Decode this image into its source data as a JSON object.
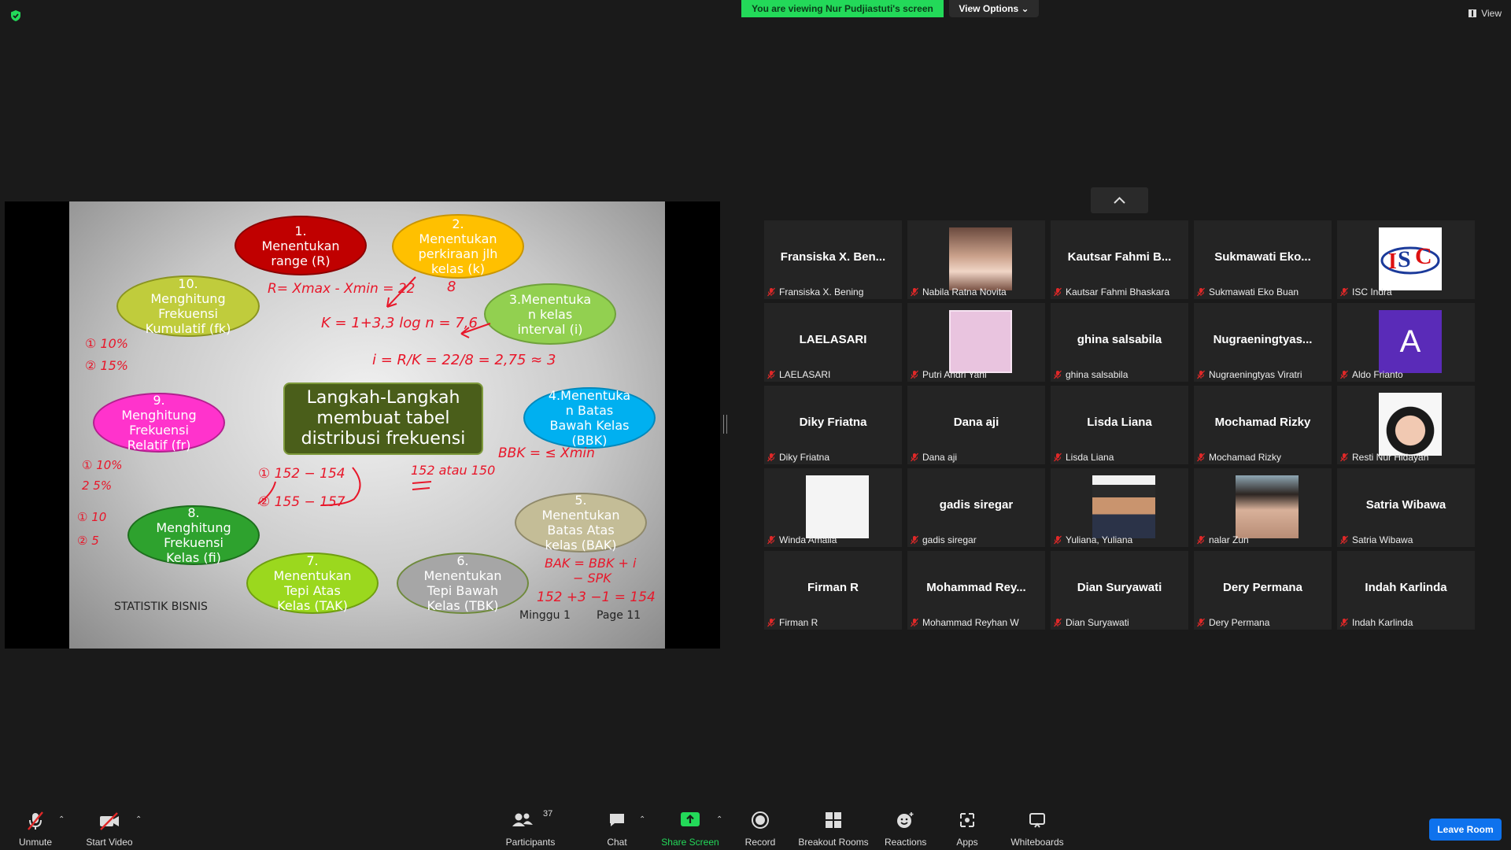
{
  "banner": {
    "viewing_text": "You are viewing Nur Pudjiastuti's screen",
    "view_options_label": "View Options",
    "view_label": "View"
  },
  "slide": {
    "center_title": "Langkah-Langkah\nmembuat tabel\ndistribusi frekuensi",
    "steps": [
      {
        "label": "1.\nMenentukan\nrange (R)",
        "color": "#c00000"
      },
      {
        "label": "2.\nMenentukan\nperkiraan jlh\nkelas (k)",
        "color": "#ffc000"
      },
      {
        "label": "3.Menentuka\nn kelas\ninterval (i)",
        "color": "#92d050"
      },
      {
        "label": "4.Menentuka\nn Batas\nBawah Kelas\n(BBK)",
        "color": "#00b0f0"
      },
      {
        "label": "5.\nMenentukan\nBatas Atas\nkelas (BAK)",
        "color": "#c4bd97"
      },
      {
        "label": "6.\nMenentukan\nTepi Bawah\nKelas (TBK)",
        "color": "#a6a6a6"
      },
      {
        "label": "7.\nMenentukan\nTepi Atas\nKelas (TAK)",
        "color": "#9bd81e"
      },
      {
        "label": "8.\nMenghitung\nFrekuensi\nKelas (fi)",
        "color": "#2ea22e"
      },
      {
        "label": "9.\nMenghitung\nFrekuensi\nRelatif (fr)",
        "color": "#ff33cc"
      },
      {
        "label": "10.\nMenghitung\nFrekuensi\nKumulatif (fk)",
        "color": "#c0cc3c"
      }
    ],
    "footer_left": "STATISTIK BISNIS",
    "footer_week": "Minggu   1",
    "footer_page": "Page   11",
    "handwriting": {
      "range": "R= Xmax - Xmin = 22",
      "k_value": "8",
      "k_formula": "K = 1+3,3 log n = 7,6",
      "i_formula": "i = R/K = 22/8 = 2,75 ≈ 3",
      "bbk": "BBK = ≤ Xmin",
      "bak_1": "BAK = BBK + i",
      "bak_2": "− SPK",
      "bak_3": "152 +3 −1 = 154",
      "fk_1": "① 10%",
      "fk_2": "② 15%",
      "fr_1": "① 10%",
      "fr_2": "2  5%",
      "fi_1": "① 10",
      "fi_2": "② 5",
      "class_1": "① 152 − 154",
      "class_2": "② 155 − 157",
      "atau": "152 atau 150"
    }
  },
  "gallery": [
    {
      "big": "Fransiska X. Ben...",
      "name": "Fransiska X. Bening"
    },
    {
      "big": "",
      "name": "Nabila Ratna Novita",
      "photo": "girl-photo"
    },
    {
      "big": "Kautsar Fahmi B...",
      "name": "Kautsar Fahmi Bhaskara"
    },
    {
      "big": "Sukmawati  Eko...",
      "name": "Sukmawati Eko Buan"
    },
    {
      "big": "",
      "name": "ISC Indra",
      "photo": "isc-logo"
    },
    {
      "big": "LAELASARI",
      "name": "LAELASARI"
    },
    {
      "big": "",
      "name": "Putri Andri Yani",
      "photo": "pink-square"
    },
    {
      "big": "ghina salsabila",
      "name": "ghina salsabila"
    },
    {
      "big": "Nugraeningtyas...",
      "name": "Nugraeningtyas Viratri"
    },
    {
      "big": "",
      "name": "Aldo Frianto",
      "photo": "letter-avatar",
      "letter": "A"
    },
    {
      "big": "Diky Friatna",
      "name": "Diky Friatna"
    },
    {
      "big": "Dana aji",
      "name": "Dana aji"
    },
    {
      "big": "Lisda Liana",
      "name": "Lisda Liana"
    },
    {
      "big": "Mochamad Rizky",
      "name": "Mochamad Rizky"
    },
    {
      "big": "",
      "name": "Resti Nur Hidayah",
      "photo": "girl-hijab-photo"
    },
    {
      "big": "",
      "name": "Winda Amalia",
      "photo": "white-square"
    },
    {
      "big": "gadis siregar",
      "name": "gadis siregar"
    },
    {
      "big": "",
      "name": "Yuliana, Yuliana",
      "photo": "student-photo"
    },
    {
      "big": "",
      "name": "nalar Zun",
      "photo": "woman-photo"
    },
    {
      "big": "Satria Wibawa",
      "name": "Satria Wibawa"
    },
    {
      "big": "Firman R",
      "name": "Firman R"
    },
    {
      "big": "Mohammad  Rey...",
      "name": "Mohammad Reyhan W"
    },
    {
      "big": "Dian Suryawati",
      "name": "Dian Suryawati"
    },
    {
      "big": "Dery Permana",
      "name": "Dery Permana"
    },
    {
      "big": "Indah Karlinda",
      "name": "Indah Karlinda"
    }
  ],
  "toolbar": {
    "unmute": "Unmute",
    "start_video": "Start Video",
    "participants": "Participants",
    "participants_count": "37",
    "chat": "Chat",
    "share_screen": "Share Screen",
    "record": "Record",
    "breakout_rooms": "Breakout Rooms",
    "reactions": "Reactions",
    "apps": "Apps",
    "whiteboards": "Whiteboards",
    "leave_room": "Leave Room"
  },
  "colors": {
    "banner_green": "#23d959",
    "share_green": "#23d959",
    "leave_blue": "#0e72ed",
    "muted_red": "#e02828",
    "ink_red": "#e8172a"
  }
}
